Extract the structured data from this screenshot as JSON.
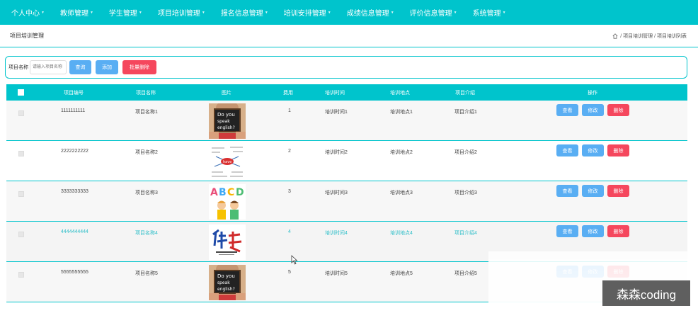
{
  "nav": [
    {
      "label": "个人中心"
    },
    {
      "label": "教师管理"
    },
    {
      "label": "学生管理"
    },
    {
      "label": "项目培训管理"
    },
    {
      "label": "报名信息管理"
    },
    {
      "label": "培训安排管理"
    },
    {
      "label": "成绩信息管理"
    },
    {
      "label": "评价信息管理"
    },
    {
      "label": "系统管理"
    }
  ],
  "header": {
    "title": "项目培训管理",
    "breadcrumb": "/ 项目培训管理 / 项目培训列表"
  },
  "search": {
    "label": "项目名称",
    "placeholder": "请输入项目名称",
    "search_btn": "查询",
    "add_btn": "添加",
    "batch_delete_btn": "批量删除"
  },
  "table": {
    "columns": [
      "项目编号",
      "项目名称",
      "图片",
      "费用",
      "培训时间",
      "培训地点",
      "项目介绍",
      "操作"
    ],
    "actions": {
      "view": "查看",
      "edit": "修改",
      "delete": "删除"
    },
    "rows": [
      {
        "id": "1111111111",
        "name": "项目名称1",
        "fee": "1",
        "time": "培训时间1",
        "place": "培训地点1",
        "intro": "项目介绍1",
        "image": "do-you-speak-english-image"
      },
      {
        "id": "2222222222",
        "name": "项目名称2",
        "fee": "2",
        "time": "培训时间2",
        "place": "培训地点2",
        "intro": "项目介绍2",
        "image": "word-cloud-image"
      },
      {
        "id": "3333333333",
        "name": "项目名称3",
        "fee": "3",
        "time": "培训时间3",
        "place": "培训地点3",
        "intro": "项目介绍3",
        "image": "abcd-kids-image"
      },
      {
        "id": "4444444444",
        "name": "项目名称4",
        "fee": "4",
        "time": "培训时间4",
        "place": "培训地点4",
        "intro": "项目介绍4",
        "image": "health-calligraphy-image"
      },
      {
        "id": "5555555555",
        "name": "项目名称5",
        "fee": "5",
        "time": "培训时间5",
        "place": "培训地点5",
        "intro": "项目介绍5",
        "image": "do-you-speak-english-image"
      }
    ]
  },
  "watermark": "森森coding",
  "colors": {
    "primary": "#00c4cc",
    "button_blue": "#59aef3",
    "button_red": "#f5475d",
    "highlight_text": "#2fbfc9"
  }
}
